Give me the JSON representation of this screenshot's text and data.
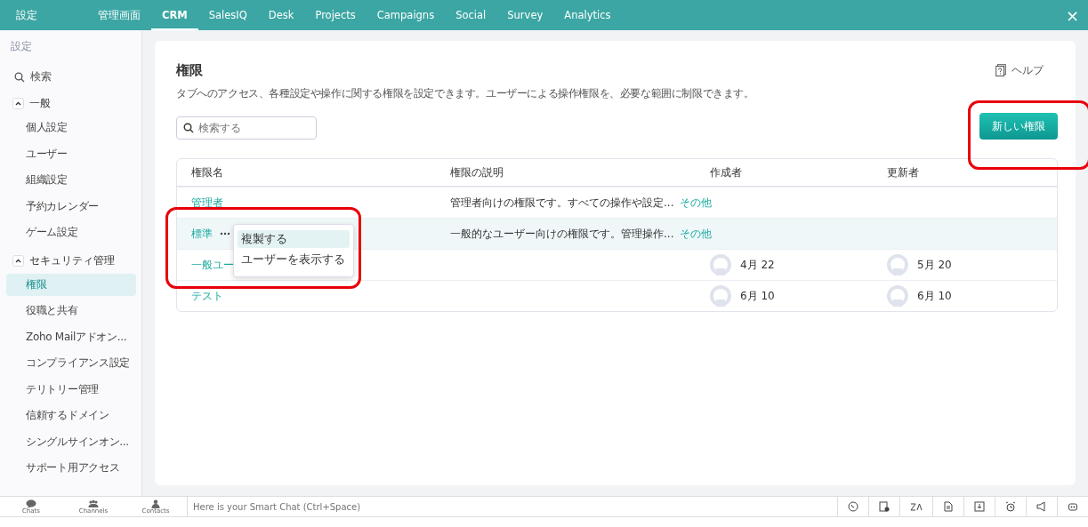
{
  "topbar": {
    "title": "設定",
    "close": "×",
    "tabs": [
      {
        "label": "管理画面",
        "selected": false
      },
      {
        "label": "CRM",
        "selected": true
      },
      {
        "label": "SalesIQ",
        "selected": false
      },
      {
        "label": "Desk",
        "selected": false
      },
      {
        "label": "Projects",
        "selected": false
      },
      {
        "label": "Campaigns",
        "selected": false
      },
      {
        "label": "Social",
        "selected": false
      },
      {
        "label": "Survey",
        "selected": false
      },
      {
        "label": "Analytics",
        "selected": false
      }
    ]
  },
  "sidebar": {
    "heading": "設定",
    "search": "検索",
    "sections": [
      {
        "label": "一般",
        "expanded": true,
        "children": [
          {
            "label": "個人設定",
            "selected": false
          },
          {
            "label": "ユーザー",
            "selected": false
          },
          {
            "label": "組織設定",
            "selected": false
          },
          {
            "label": "予約カレンダー",
            "selected": false
          },
          {
            "label": "ゲーム設定",
            "selected": false
          }
        ]
      },
      {
        "label": "セキュリティ管理",
        "expanded": true,
        "children": [
          {
            "label": "権限",
            "selected": true
          },
          {
            "label": "役職と共有",
            "selected": false
          },
          {
            "label": "Zoho Mailアドオン...",
            "selected": false
          },
          {
            "label": "コンプライアンス設定",
            "selected": false
          },
          {
            "label": "テリトリー管理",
            "selected": false
          },
          {
            "label": "信頼するドメイン",
            "selected": false
          },
          {
            "label": "シングルサインオン...",
            "selected": false
          },
          {
            "label": "サポート用アクセス",
            "selected": false
          }
        ]
      }
    ]
  },
  "page": {
    "title": "権限",
    "help": "ヘルプ",
    "description": "タブへのアクセス、各種設定や操作に関する権限を設定できます。ユーザーによる操作権限を、必要な範囲に制限できます。",
    "search": {
      "placeholder": "検索する"
    },
    "new_button": "新しい権限"
  },
  "table": {
    "columns": [
      "権限名",
      "権限の説明",
      "作成者",
      "更新者"
    ],
    "rows": [
      {
        "name": "管理者",
        "highlighted": false,
        "menu_open": false,
        "description": "管理者向けの権限です。すべての操作や設定...",
        "more": "その他"
      },
      {
        "name": "標準",
        "highlighted": true,
        "menu_open": true,
        "description": "一般的なユーザー向けの権限です。管理操作...",
        "more": "その他"
      },
      {
        "name": "一般ユー",
        "highlighted": false,
        "menu_open": false,
        "creator": "4月 22",
        "updater": "5月 20"
      },
      {
        "name": "テスト",
        "highlighted": false,
        "menu_open": false,
        "creator": "6月 10",
        "updater": "6月 10"
      }
    ]
  },
  "context_menu": {
    "items": [
      {
        "label": "複製する",
        "selected": true
      },
      {
        "label": "ユーザーを表示する",
        "selected": false
      }
    ]
  },
  "chat_bar": {
    "items": [
      {
        "kind": "chat",
        "label": "Chats"
      },
      {
        "kind": "channel",
        "label": "Channels"
      },
      {
        "kind": "contact",
        "label": "Contacts"
      }
    ],
    "placeholder": "Here is your Smart Chat (Ctrl+Space)"
  }
}
